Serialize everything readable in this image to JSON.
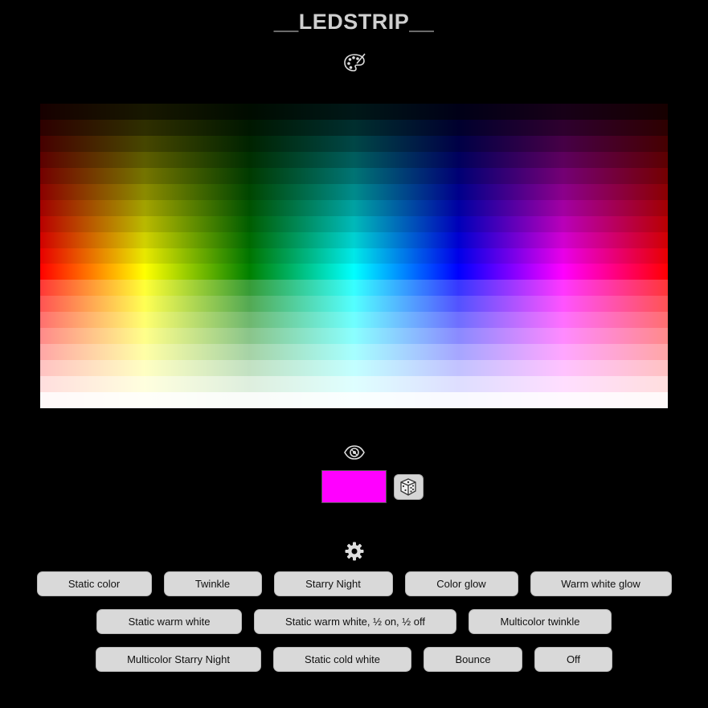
{
  "header": {
    "title": "__LEDSTRIP__"
  },
  "icons": {
    "palette": "palette-icon",
    "preview": "eye-icon",
    "random": "dice-icon",
    "settings": "gear-icon"
  },
  "color_picker": {
    "hues": [
      "red",
      "yellow",
      "green",
      "cyan",
      "blue",
      "magenta",
      "red"
    ],
    "rows": 20
  },
  "preview": {
    "selected_color": "#ff00ff"
  },
  "modes": {
    "row1": [
      {
        "label": "Static color"
      },
      {
        "label": "Twinkle"
      },
      {
        "label": "Starry Night"
      },
      {
        "label": "Color glow"
      },
      {
        "label": "Warm white glow"
      }
    ],
    "row2": [
      {
        "label": "Static warm white"
      },
      {
        "label": "Static warm white, ½ on, ½ off"
      },
      {
        "label": "Multicolor twinkle"
      }
    ],
    "row3": [
      {
        "label": "Multicolor Starry Night"
      },
      {
        "label": "Static cold white"
      },
      {
        "label": "Bounce"
      },
      {
        "label": "Off"
      }
    ]
  }
}
